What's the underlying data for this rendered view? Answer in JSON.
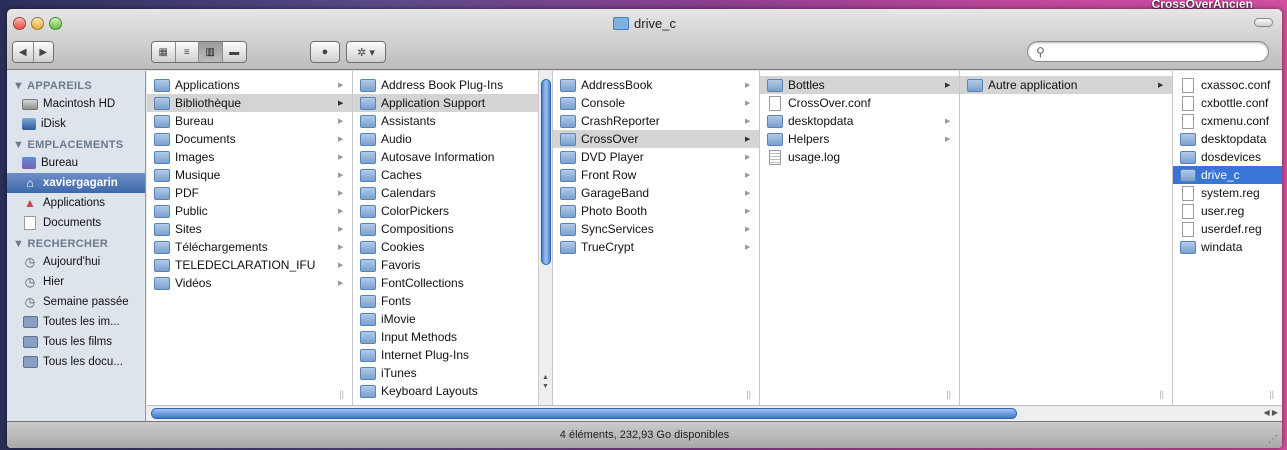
{
  "desktop": {
    "label": "CrossOverAncien"
  },
  "window": {
    "title": "drive_c"
  },
  "toolbar": {
    "back_label": "◀",
    "forward_label": "▶",
    "view_icons": "▦",
    "view_list": "≡",
    "view_columns": "▥",
    "view_coverflow": "▬",
    "quicklook": "●",
    "action": "✲ ▾",
    "search_placeholder": ""
  },
  "sidebar": {
    "sections": [
      {
        "title": "▼ APPAREILS",
        "items": [
          {
            "label": "Macintosh HD",
            "icon": "hard-drive-icon"
          },
          {
            "label": "iDisk",
            "icon": "idisk-icon"
          }
        ]
      },
      {
        "title": "▼ EMPLACEMENTS",
        "items": [
          {
            "label": "Bureau",
            "icon": "desktop-icon"
          },
          {
            "label": "xaviergagarin",
            "icon": "home-icon",
            "selected": true
          },
          {
            "label": "Applications",
            "icon": "applications-icon"
          },
          {
            "label": "Documents",
            "icon": "documents-icon"
          }
        ]
      },
      {
        "title": "▼ RECHERCHER",
        "items": [
          {
            "label": "Aujourd'hui",
            "icon": "clock-icon"
          },
          {
            "label": "Hier",
            "icon": "clock-icon"
          },
          {
            "label": "Semaine passée",
            "icon": "clock-icon"
          },
          {
            "label": "Toutes les im...",
            "icon": "smart-folder-icon"
          },
          {
            "label": "Tous les films",
            "icon": "smart-folder-icon"
          },
          {
            "label": "Tous les docu...",
            "icon": "smart-folder-icon"
          }
        ]
      }
    ]
  },
  "columns": [
    {
      "items": [
        {
          "label": "Applications",
          "type": "folder",
          "arrow": true
        },
        {
          "label": "Bibliothèque",
          "type": "folder",
          "arrow": true,
          "state": "gray"
        },
        {
          "label": "Bureau",
          "type": "folder",
          "arrow": true
        },
        {
          "label": "Documents",
          "type": "folder",
          "arrow": true
        },
        {
          "label": "Images",
          "type": "folder",
          "arrow": true
        },
        {
          "label": "Musique",
          "type": "folder",
          "arrow": true
        },
        {
          "label": "PDF",
          "type": "folder",
          "arrow": true
        },
        {
          "label": "Public",
          "type": "folder",
          "arrow": true
        },
        {
          "label": "Sites",
          "type": "folder",
          "arrow": true
        },
        {
          "label": "Téléchargements",
          "type": "folder",
          "arrow": true
        },
        {
          "label": "TELEDECLARATION_IFU",
          "type": "folder",
          "arrow": true
        },
        {
          "label": "Vidéos",
          "type": "folder",
          "arrow": true
        }
      ]
    },
    {
      "items": [
        {
          "label": "Address Book Plug-Ins",
          "type": "folder",
          "arrow": true
        },
        {
          "label": "Application Support",
          "type": "folder",
          "arrow": true,
          "state": "gray"
        },
        {
          "label": "Assistants",
          "type": "folder",
          "arrow": true
        },
        {
          "label": "Audio",
          "type": "folder",
          "arrow": true
        },
        {
          "label": "Autosave Information",
          "type": "folder",
          "arrow": true
        },
        {
          "label": "Caches",
          "type": "folder",
          "arrow": true
        },
        {
          "label": "Calendars",
          "type": "folder",
          "arrow": true
        },
        {
          "label": "ColorPickers",
          "type": "folder",
          "arrow": true
        },
        {
          "label": "Compositions",
          "type": "folder",
          "arrow": true
        },
        {
          "label": "Cookies",
          "type": "folder",
          "arrow": true
        },
        {
          "label": "Favoris",
          "type": "folder",
          "arrow": true
        },
        {
          "label": "FontCollections",
          "type": "folder",
          "arrow": true
        },
        {
          "label": "Fonts",
          "type": "folder",
          "arrow": true
        },
        {
          "label": "iMovie",
          "type": "folder",
          "arrow": true
        },
        {
          "label": "Input Methods",
          "type": "folder",
          "arrow": true
        },
        {
          "label": "Internet Plug-Ins",
          "type": "folder",
          "arrow": true
        },
        {
          "label": "iTunes",
          "type": "folder",
          "arrow": true
        },
        {
          "label": "Keyboard Layouts",
          "type": "folder",
          "arrow": true
        }
      ]
    },
    {
      "items": [
        {
          "label": "AddressBook",
          "type": "folder",
          "arrow": true
        },
        {
          "label": "Console",
          "type": "folder",
          "arrow": true
        },
        {
          "label": "CrashReporter",
          "type": "folder",
          "arrow": true
        },
        {
          "label": "CrossOver",
          "type": "folder",
          "arrow": true,
          "state": "gray"
        },
        {
          "label": "DVD Player",
          "type": "folder",
          "arrow": true
        },
        {
          "label": "Front Row",
          "type": "folder",
          "arrow": true
        },
        {
          "label": "GarageBand",
          "type": "folder",
          "arrow": true
        },
        {
          "label": "Photo Booth",
          "type": "folder",
          "arrow": true
        },
        {
          "label": "SyncServices",
          "type": "folder",
          "arrow": true
        },
        {
          "label": "TrueCrypt",
          "type": "folder",
          "arrow": true
        }
      ]
    },
    {
      "items": [
        {
          "label": "Bottles",
          "type": "folder",
          "arrow": true,
          "state": "gray"
        },
        {
          "label": "CrossOver.conf",
          "type": "file",
          "arrow": false
        },
        {
          "label": "desktopdata",
          "type": "folder",
          "arrow": true
        },
        {
          "label": "Helpers",
          "type": "folder",
          "arrow": true
        },
        {
          "label": "usage.log",
          "type": "doc",
          "arrow": false
        }
      ]
    },
    {
      "items": [
        {
          "label": "Autre application",
          "type": "folder",
          "arrow": true,
          "state": "gray"
        }
      ]
    },
    {
      "items": [
        {
          "label": "cxassoc.conf",
          "type": "file",
          "arrow": false
        },
        {
          "label": "cxbottle.conf",
          "type": "file",
          "arrow": false
        },
        {
          "label": "cxmenu.conf",
          "type": "file",
          "arrow": false
        },
        {
          "label": "desktopdata",
          "type": "folder",
          "arrow": false
        },
        {
          "label": "dosdevices",
          "type": "folder",
          "arrow": false
        },
        {
          "label": "drive_c",
          "type": "folder",
          "arrow": false,
          "state": "blue"
        },
        {
          "label": "system.reg",
          "type": "file",
          "arrow": false
        },
        {
          "label": "user.reg",
          "type": "file",
          "arrow": false
        },
        {
          "label": "userdef.reg",
          "type": "file",
          "arrow": false
        },
        {
          "label": "windata",
          "type": "folder",
          "arrow": false
        }
      ]
    }
  ],
  "status": {
    "text": "4 éléments, 232,93 Go disponibles"
  },
  "colors": {
    "selection_blue": "#3875d7",
    "sidebar_bg": "#dde4ec"
  }
}
